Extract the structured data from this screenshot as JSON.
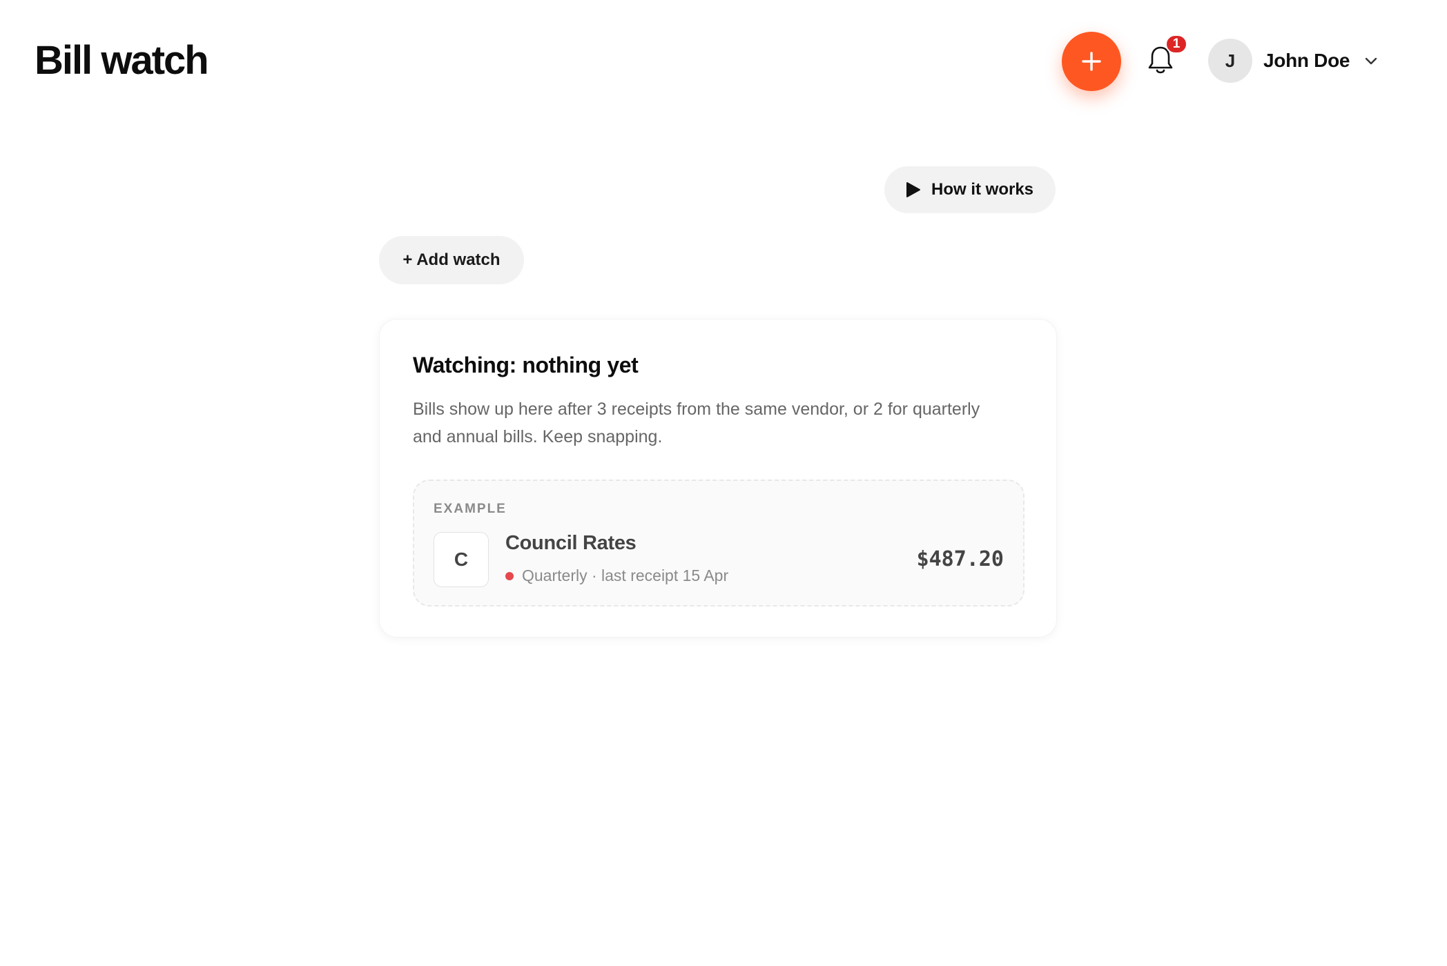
{
  "header": {
    "app_title": "Bill watch",
    "notification_count": "1",
    "user": {
      "initial": "J",
      "name": "John Doe"
    }
  },
  "toolbar": {
    "how_it_works_label": "How it works",
    "add_watch_label": "+ Add watch"
  },
  "watch_card": {
    "title": "Watching: nothing yet",
    "description": "Bills show up here after 3 receipts from the same vendor, or 2 for quarterly and annual bills. Keep snapping.",
    "example": {
      "label": "EXAMPLE",
      "vendor_initial": "C",
      "vendor_name": "Council Rates",
      "meta": "Quarterly · last receipt 15 Apr",
      "amount": "$487.20"
    }
  },
  "colors": {
    "accent": "#ff5722",
    "badge": "#dc2626",
    "status_dot": "#e5484d"
  },
  "icons": [
    "plus-icon",
    "bell-icon",
    "chevron-down-icon",
    "play-icon"
  ]
}
